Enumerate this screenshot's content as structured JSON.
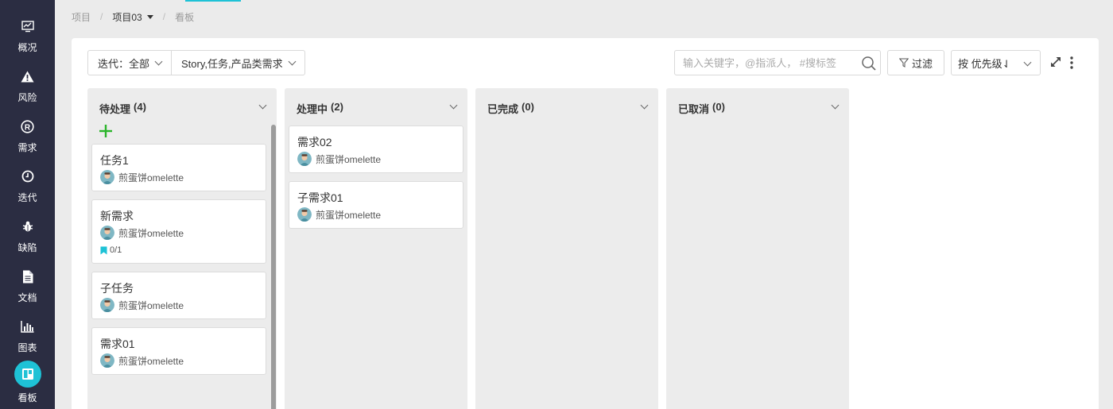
{
  "sidebar": {
    "items": [
      {
        "label": "概况",
        "icon": "monitor-chart-icon"
      },
      {
        "label": "风险",
        "icon": "warning-icon"
      },
      {
        "label": "需求",
        "icon": "registered-icon"
      },
      {
        "label": "迭代",
        "icon": "clock-icon"
      },
      {
        "label": "缺陷",
        "icon": "bug-icon"
      },
      {
        "label": "文档",
        "icon": "document-icon"
      },
      {
        "label": "图表",
        "icon": "bar-chart-icon"
      },
      {
        "label": "看板",
        "icon": "kanban-icon",
        "active": true
      }
    ]
  },
  "breadcrumb": {
    "root": "项目",
    "project": "项目03",
    "current": "看板"
  },
  "toolbar": {
    "iteration_filter": "迭代：全部",
    "type_filter": "Story,任务,产品类需求",
    "search_placeholder": "输入关键字，@指派人， #搜标签",
    "filter_label": "过滤",
    "sort_label": "按 优先级⇃"
  },
  "columns": [
    {
      "title": "待处理",
      "count": "(4)",
      "cards": [
        {
          "title": "任务1",
          "assignee": "煎蛋饼omelette"
        },
        {
          "title": "新需求",
          "assignee": "煎蛋饼omelette",
          "meta": "0/1"
        },
        {
          "title": "子任务",
          "assignee": "煎蛋饼omelette"
        },
        {
          "title": "需求01",
          "assignee": "煎蛋饼omelette"
        }
      ]
    },
    {
      "title": "处理中",
      "count": "(2)",
      "cards": [
        {
          "title": "需求02",
          "assignee": "煎蛋饼omelette"
        },
        {
          "title": "子需求01",
          "assignee": "煎蛋饼omelette"
        }
      ]
    },
    {
      "title": "已完成",
      "count": "(0)",
      "cards": []
    },
    {
      "title": "已取消",
      "count": "(0)",
      "cards": []
    }
  ],
  "colors": {
    "sidebar_bg": "#2b2d42",
    "accent": "#1ec2d6",
    "add_green": "#2bb52b"
  }
}
